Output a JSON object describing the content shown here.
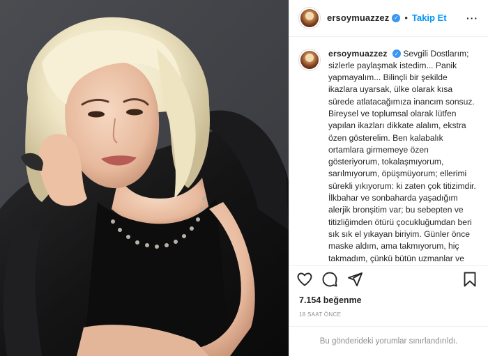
{
  "post": {
    "username": "ersoymuazzez",
    "follow_label": "Takip Et",
    "separator": "•",
    "more_label": "···",
    "verified_mark": "✓",
    "caption": "Sevgili Dostlarım; sizlerle paylaşmak istedim... Panik yapmayalım... Bilinçli bir şekilde ikazlara uyarsak, ülke olarak kısa sürede atlatacağımıza inancım sonsuz. Bireysel ve toplumsal olarak lütfen yapılan ikazları dikkate alalım, ekstra özen gösterelim. Ben kalabalık ortamlara girmemeye özen gösteriyorum, tokalaşmıyorum, sarılmıyorum, öpüşmüyorum; ellerimi sürekli yıkıyorum: ki zaten çok titizimdir. İlkbahar ve sonbaharda yaşadığım alerjik bronşitim var; bu sebepten ve titizliğimden ötürü çocukluğumdan beri sık sık el yıkayan biriyim. Günler önce maske aldım, ama takmıyorum, hiç takmadım, çünkü bütün uzmanlar ve Sağlık Bakanımız maskeyi hasta olan kişinin takması",
    "likes": "7.154 beğenme",
    "timestamp": "18 SAAT ÖNCE",
    "comments_notice": "Bu gönderideki yorumlar sınırlandırıldı.",
    "icons": {
      "like": "heart-icon",
      "comment": "comment-icon",
      "share": "share-icon",
      "save": "bookmark-icon",
      "verified": "verified-badge-icon"
    },
    "colors": {
      "accent": "#0095f6",
      "verified": "#3897f0",
      "text": "#262626",
      "muted": "#8e8e8e",
      "border": "#efefef"
    }
  }
}
